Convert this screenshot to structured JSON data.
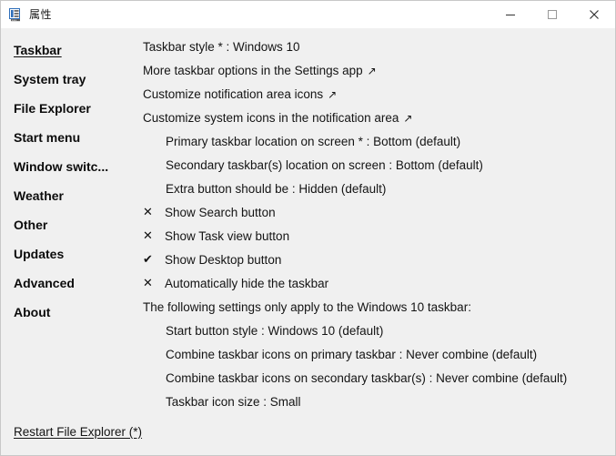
{
  "window": {
    "title": "属性",
    "icon": "properties-icon",
    "accent_color": "#2f6fba",
    "titlebar_bg": "#ffffff",
    "body_bg": "#f0f0f0",
    "border_color": "#c8c8c8",
    "controls": {
      "minimize": "—",
      "maximize": "□",
      "close": "✕"
    }
  },
  "sidebar": {
    "items": [
      {
        "label": "Taskbar",
        "active": true
      },
      {
        "label": "System tray",
        "active": false
      },
      {
        "label": "File Explorer",
        "active": false
      },
      {
        "label": "Start menu",
        "active": false
      },
      {
        "label": "Window switc...",
        "active": false
      },
      {
        "label": "Weather",
        "active": false
      },
      {
        "label": "Other",
        "active": false
      },
      {
        "label": "Updates",
        "active": false
      },
      {
        "label": "Advanced",
        "active": false
      },
      {
        "label": "About",
        "active": false
      }
    ]
  },
  "main": {
    "rows": [
      {
        "type": "setting",
        "text": "Taskbar style * : Windows 10"
      },
      {
        "type": "link",
        "text": "More taskbar options in the Settings app",
        "arrow": "↗"
      },
      {
        "type": "link",
        "text": "Customize notification area icons",
        "arrow": "↗"
      },
      {
        "type": "link",
        "text": "Customize system icons in the notification area",
        "arrow": "↗"
      },
      {
        "type": "setting-indent",
        "text": "Primary taskbar location on screen * : Bottom (default)"
      },
      {
        "type": "setting-indent",
        "text": "Secondary taskbar(s) location on screen : Bottom (default)"
      },
      {
        "type": "setting-indent",
        "text": "Extra button should be : Hidden (default)"
      },
      {
        "type": "check",
        "mark": "✕",
        "checked": false,
        "text": "Show Search button"
      },
      {
        "type": "check",
        "mark": "✕",
        "checked": false,
        "text": "Show Task view button"
      },
      {
        "type": "check",
        "mark": "✔",
        "checked": true,
        "text": "Show Desktop button"
      },
      {
        "type": "check",
        "mark": "✕",
        "checked": false,
        "text": "Automatically hide the taskbar"
      },
      {
        "type": "heading",
        "text": "The following settings only apply to the Windows 10 taskbar:"
      },
      {
        "type": "setting-indent",
        "text": "Start button style : Windows 10 (default)"
      },
      {
        "type": "setting-indent",
        "text": "Combine taskbar icons on primary taskbar : Never combine (default)"
      },
      {
        "type": "setting-indent",
        "text": "Combine taskbar icons on secondary taskbar(s) : Never combine (default)"
      },
      {
        "type": "setting-indent",
        "text": "Taskbar icon size : Small"
      }
    ]
  },
  "footer": {
    "restart_label": "Restart File Explorer (*)"
  }
}
